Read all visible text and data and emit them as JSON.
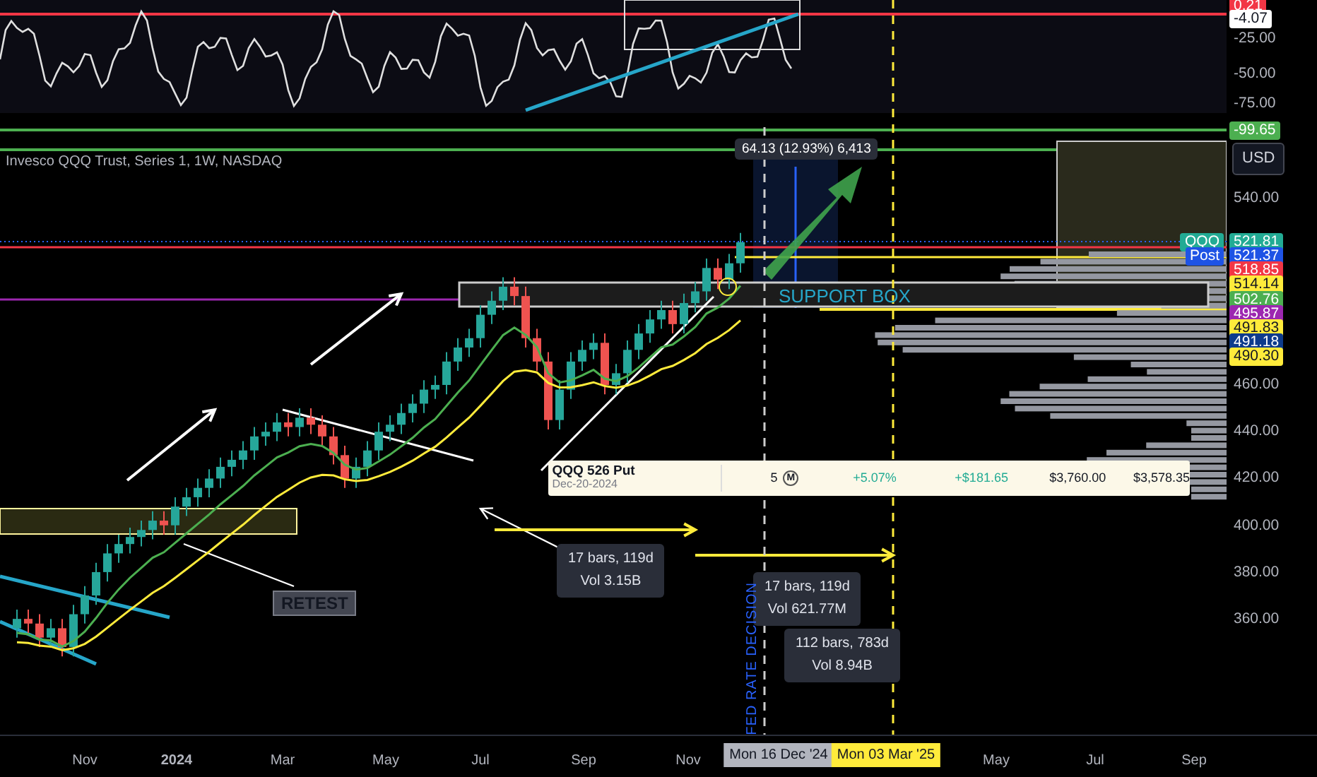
{
  "oscillator": {
    "axis_labels": [
      {
        "text": "0.21",
        "kind": "badge",
        "color": "#f23645"
      },
      {
        "text": "-4.07",
        "kind": "badge",
        "color": "#ffffff"
      },
      {
        "text": "-25.00",
        "kind": "plain"
      },
      {
        "text": "-50.00",
        "kind": "plain"
      },
      {
        "text": "-75.00",
        "kind": "plain"
      }
    ]
  },
  "chart": {
    "title": "Invesco QQQ Trust, Series 1, 1W, NASDAQ",
    "measure_label": "64.13 (12.93%) 6,413",
    "annotations": [
      {
        "text": "SUPPORT BOX",
        "kind": "plain"
      },
      {
        "text": "RETEST",
        "kind": "boxed"
      }
    ],
    "position": {
      "symbol": "QQQ 526 Put",
      "expiry": "Dec-20-2024",
      "quantity": "5",
      "type_badge": "M",
      "change_percent": "+5.07%",
      "profit": "+$181.65",
      "cost": "$3,760.00",
      "value": "$3,578.35"
    },
    "range_boxes": [
      {
        "line1": "17 bars, 119d",
        "line2": "Vol 3.15B"
      },
      {
        "line1": "17 bars, 119d",
        "line2": "Vol 621.77M"
      },
      {
        "line1": "112 bars, 783d",
        "line2": "Vol 8.94B"
      }
    ],
    "event_label": "FED RATE DECISION"
  },
  "price_axis": {
    "currency": "USD",
    "labels": [
      {
        "text": "-99.65",
        "kind": "badge",
        "color": "#4caf50"
      },
      {
        "text": "540.00",
        "kind": "plain"
      },
      {
        "text": "521.81",
        "kind": "badge",
        "color": "#22ab94",
        "tag": "QQQ"
      },
      {
        "text": "521.37",
        "kind": "badge",
        "color": "#1e53e5",
        "tag": "Post"
      },
      {
        "text": "518.85",
        "kind": "badge",
        "color": "#f23645"
      },
      {
        "text": "514.14",
        "kind": "badge",
        "color": "#ffeb3b"
      },
      {
        "text": "502.76",
        "kind": "badge",
        "color": "#4caf50"
      },
      {
        "text": "495.87",
        "kind": "badge",
        "color": "#9c27b0"
      },
      {
        "text": "491.83",
        "kind": "badge",
        "color": "#ffeb3b"
      },
      {
        "text": "491.18",
        "kind": "badge",
        "color": "#0d3b8c"
      },
      {
        "text": "490.30",
        "kind": "badge",
        "color": "#ffeb3b"
      },
      {
        "text": "460.00",
        "kind": "plain"
      },
      {
        "text": "440.00",
        "kind": "plain"
      },
      {
        "text": "420.00",
        "kind": "plain"
      },
      {
        "text": "400.00",
        "kind": "plain"
      },
      {
        "text": "380.00",
        "kind": "plain"
      },
      {
        "text": "360.00",
        "kind": "plain"
      }
    ]
  },
  "time_axis": {
    "labels": [
      {
        "text": "Nov",
        "kind": "plain"
      },
      {
        "text": "2024",
        "kind": "bold"
      },
      {
        "text": "Mar",
        "kind": "plain"
      },
      {
        "text": "May",
        "kind": "plain"
      },
      {
        "text": "Jul",
        "kind": "plain"
      },
      {
        "text": "Sep",
        "kind": "plain"
      },
      {
        "text": "Nov",
        "kind": "plain"
      },
      {
        "text": "Mon 16 Dec '24",
        "kind": "badge",
        "color": "#b2b5be"
      },
      {
        "text": "Mon 03 Mar '25",
        "kind": "badge",
        "color": "#ffeb3b"
      },
      {
        "text": "May",
        "kind": "plain"
      },
      {
        "text": "Jul",
        "kind": "plain"
      },
      {
        "text": "Sep",
        "kind": "plain"
      }
    ]
  }
}
